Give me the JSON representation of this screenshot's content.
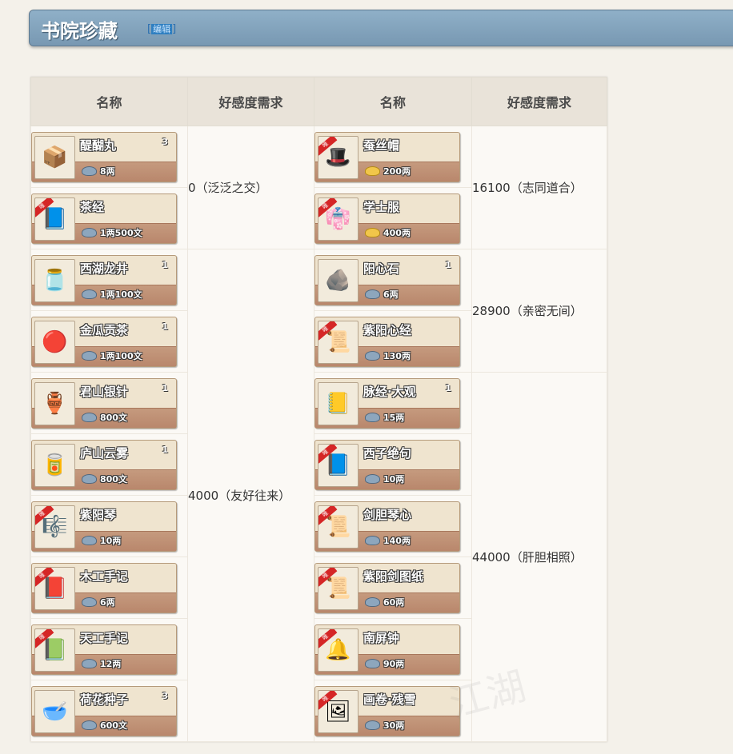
{
  "page": {
    "title": "书院珍藏",
    "edit_label": "编辑"
  },
  "table": {
    "headers": [
      "名称",
      "好感度需求",
      "名称",
      "好感度需求"
    ]
  },
  "left_items": [
    {
      "name": "醍醐丸",
      "qty": "3",
      "price": "8两",
      "coin": "silver",
      "ribbon": false,
      "icon": "book-box-icon",
      "glyph": "📦"
    },
    {
      "name": "茶经",
      "qty": "",
      "price": "1两500文",
      "coin": "silver",
      "ribbon": true,
      "icon": "book-icon",
      "glyph": "📘"
    },
    {
      "name": "西湖龙井",
      "qty": "1",
      "price": "1两100文",
      "coin": "silver",
      "ribbon": false,
      "icon": "tea-jar-icon",
      "glyph": "🫙"
    },
    {
      "name": "金瓜贡茶",
      "qty": "1",
      "price": "1两100文",
      "coin": "silver",
      "ribbon": false,
      "icon": "tea-cake-icon",
      "glyph": "🔴"
    },
    {
      "name": "君山银针",
      "qty": "1",
      "price": "800文",
      "coin": "silver",
      "ribbon": false,
      "icon": "tea-pot-icon",
      "glyph": "🏺"
    },
    {
      "name": "庐山云雾",
      "qty": "1",
      "price": "800文",
      "coin": "silver",
      "ribbon": false,
      "icon": "tea-tin-icon",
      "glyph": "🥫"
    },
    {
      "name": "紫阳琴",
      "qty": "",
      "price": "10两",
      "coin": "silver",
      "ribbon": true,
      "icon": "guqin-icon",
      "glyph": "🎼"
    },
    {
      "name": "木工手记",
      "qty": "",
      "price": "6两",
      "coin": "silver",
      "ribbon": true,
      "icon": "notebook-icon",
      "glyph": "📕"
    },
    {
      "name": "天工手记",
      "qty": "",
      "price": "12两",
      "coin": "silver",
      "ribbon": true,
      "icon": "notebook-blue-icon",
      "glyph": "📗"
    },
    {
      "name": "荷花种子",
      "qty": "3",
      "price": "600文",
      "coin": "silver",
      "ribbon": false,
      "icon": "seed-bowl-icon",
      "glyph": "🥣"
    }
  ],
  "right_items": [
    {
      "name": "蚕丝帽",
      "qty": "",
      "price": "200两",
      "coin": "gold",
      "ribbon": true,
      "icon": "hat-icon",
      "glyph": "🎩"
    },
    {
      "name": "学士服",
      "qty": "",
      "price": "400两",
      "coin": "gold",
      "ribbon": true,
      "icon": "robe-icon",
      "glyph": "👘"
    },
    {
      "name": "阳心石",
      "qty": "1",
      "price": "6两",
      "coin": "silver",
      "ribbon": false,
      "icon": "red-stone-icon",
      "glyph": "🪨"
    },
    {
      "name": "紫阳心经",
      "qty": "",
      "price": "130两",
      "coin": "silver",
      "ribbon": true,
      "icon": "scroll-icon",
      "glyph": "📜"
    },
    {
      "name": "脉经·大观",
      "qty": "1",
      "price": "15两",
      "coin": "silver",
      "ribbon": false,
      "icon": "scroll-case-icon",
      "glyph": "📒"
    },
    {
      "name": "西子绝句",
      "qty": "",
      "price": "10两",
      "coin": "silver",
      "ribbon": true,
      "icon": "poem-book-icon",
      "glyph": "📘"
    },
    {
      "name": "剑胆琴心",
      "qty": "",
      "price": "140两",
      "coin": "silver",
      "ribbon": true,
      "icon": "scroll-icon",
      "glyph": "📜"
    },
    {
      "name": "紫阳剑图纸",
      "qty": "",
      "price": "60两",
      "coin": "silver",
      "ribbon": true,
      "icon": "blueprint-icon",
      "glyph": "📜"
    },
    {
      "name": "南屏钟",
      "qty": "",
      "price": "90两",
      "coin": "silver",
      "ribbon": true,
      "icon": "bell-icon",
      "glyph": "🔔"
    },
    {
      "name": "画卷·残雪",
      "qty": "",
      "price": "30两",
      "coin": "silver",
      "ribbon": true,
      "icon": "painting-scroll-icon",
      "glyph": "🖼"
    }
  ],
  "requirements": {
    "left": [
      {
        "label": "0（泛泛之交）",
        "rows": 2
      },
      {
        "label": "4000（友好往来）",
        "rows": 8
      }
    ],
    "right": [
      {
        "label": "16100（志同道合）",
        "rows": 2
      },
      {
        "label": "28900（亲密无间）",
        "rows": 2
      },
      {
        "label": "44000（肝胆相照）",
        "rows": 6
      }
    ]
  },
  "ribbon_text": "唯",
  "watermark": "江湖",
  "colors": {
    "banner": "#7898b2",
    "ribbon": "#d52626",
    "card_price_bar": "#b9876c"
  }
}
